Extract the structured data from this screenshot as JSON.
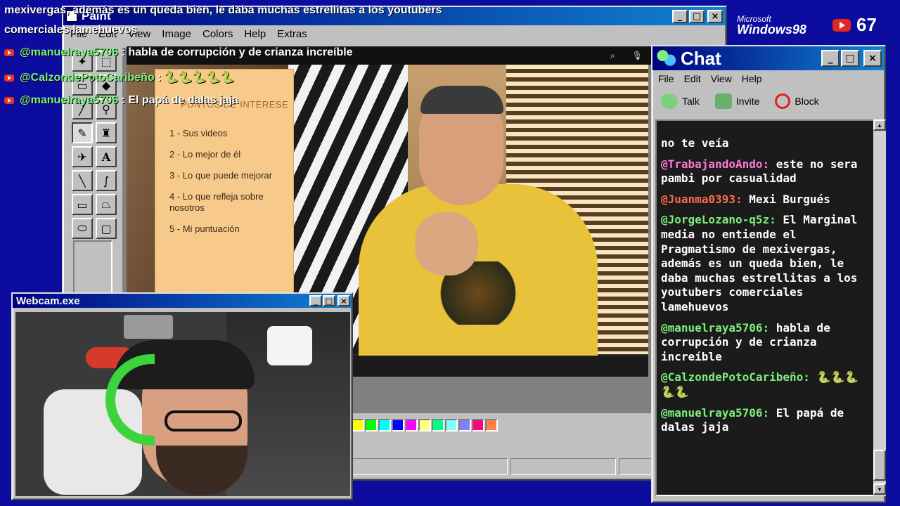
{
  "overlay": {
    "lines": [
      {
        "text": "mexivergas, además es un queda bien, le daba muchas estrellitas a los youtubers"
      },
      {
        "text": "comerciales lamehuevos"
      },
      {
        "user": "@manuelraya5706",
        "sep": " : ",
        "text": "habla de corrupción y de crianza increíble"
      },
      {
        "user": "@CalzondePotoCaribeño",
        "sep": " : ",
        "text": "🐍🐍🐍🐍🐍"
      },
      {
        "user": "@manuelraya5706",
        "sep": " : ",
        "text": "El papá de dalas jaja"
      }
    ]
  },
  "brand": {
    "microsoft": "Microsoft",
    "windows": "Windows98"
  },
  "subscribers": {
    "count": "67"
  },
  "paint": {
    "title": "Paint",
    "menu": [
      "File",
      "Edit",
      "View",
      "Image",
      "Colors",
      "Help",
      "Extras"
    ],
    "tools": [
      "select-star-icon",
      "select-rect-icon",
      "eraser-icon",
      "fill-icon",
      "picker-icon",
      "magnifier-icon",
      "pencil-icon",
      "brush-icon",
      "airbrush-icon",
      "text-icon",
      "line-icon",
      "curve-icon",
      "rect-icon",
      "polygon-icon",
      "ellipse-icon",
      "rounded-rect-icon"
    ],
    "palette": [
      "#ffff00",
      "#00ff00",
      "#00ffff",
      "#0000ff",
      "#ff00ff",
      "#ffff80",
      "#00ff80",
      "#80ffff",
      "#8080ff",
      "#ff0080",
      "#ff8040"
    ],
    "paper": {
      "header": "PUNTOS DE INTERESE",
      "items": [
        "1 - Sus videos",
        "2 - Lo mejor de él",
        "3 - Lo que puede mejorar",
        "4 - Lo que refleja sobre nosotros",
        "5 - Mi puntuación"
      ]
    },
    "video_icons": {
      "search": "⌕",
      "mic": "🎙"
    }
  },
  "webcam": {
    "title": "Webcam.exe"
  },
  "chat": {
    "title": "Chat",
    "menu": [
      "File",
      "Edit",
      "View",
      "Help"
    ],
    "toolbar": {
      "talk": "Talk",
      "invite": "Invite",
      "block": "Block"
    },
    "messages": [
      {
        "user": "",
        "text": "no te veía",
        "color": "#ffffff"
      },
      {
        "user": "@TrabajandoAndo:",
        "text": " este no sera pambi por casualidad",
        "color": "#ff7ad9"
      },
      {
        "user": "@Juanma0393:",
        "text": " Mexi Burgués",
        "color": "#ff6a4a"
      },
      {
        "user": "@JorgeLozano-q5z:",
        "text": " El Marginal media no entiende el Pragmatismo de mexivergas, además es un queda bien, le daba muchas estrellitas a los youtubers comerciales lamehuevos",
        "color": "#7cf07c"
      },
      {
        "user": "@manuelraya5706:",
        "text": " habla de corrupción y de crianza increíble",
        "color": "#7cf07c"
      },
      {
        "user": "@CalzondePotoCaribeño:",
        "text": " 🐍🐍🐍🐍🐍",
        "color": "#7cf07c"
      },
      {
        "user": "@manuelraya5706:",
        "text": " El papá de dalas jaja",
        "color": "#7cf07c"
      }
    ]
  }
}
